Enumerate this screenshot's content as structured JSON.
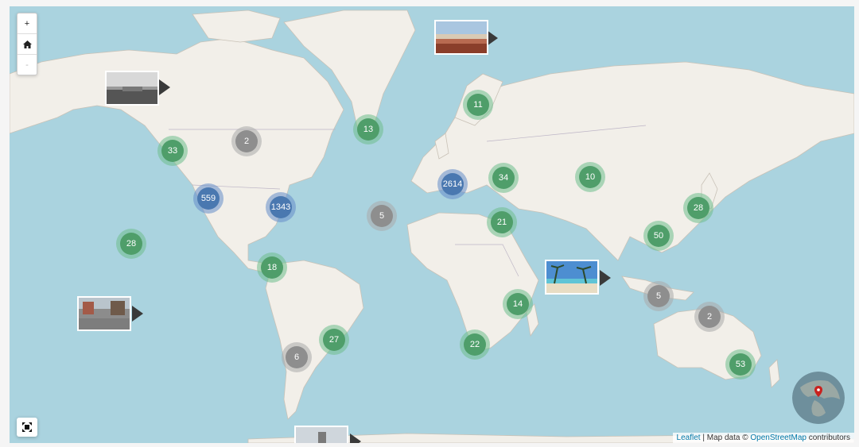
{
  "controls": {
    "zoom_in": "+",
    "home_icon": "home-icon",
    "zoom_out": "-",
    "fullscreen_icon": "fullscreen-icon"
  },
  "clusters": [
    {
      "id": "alaska",
      "count": "33",
      "color": "green"
    },
    {
      "id": "canada",
      "count": "2",
      "color": "gray"
    },
    {
      "id": "greenland",
      "count": "13",
      "color": "green"
    },
    {
      "id": "scandinavia",
      "count": "11",
      "color": "green"
    },
    {
      "id": "us-west",
      "count": "559",
      "color": "blue"
    },
    {
      "id": "us-east",
      "count": "1343",
      "color": "blue"
    },
    {
      "id": "europe",
      "count": "2614",
      "color": "blue"
    },
    {
      "id": "black-sea",
      "count": "34",
      "color": "green"
    },
    {
      "id": "russia",
      "count": "10",
      "color": "green"
    },
    {
      "id": "atlantic",
      "count": "5",
      "color": "gray"
    },
    {
      "id": "japan",
      "count": "28",
      "color": "green"
    },
    {
      "id": "hawaii",
      "count": "28",
      "color": "green"
    },
    {
      "id": "middle-east",
      "count": "21",
      "color": "green"
    },
    {
      "id": "se-asia",
      "count": "50",
      "color": "green"
    },
    {
      "id": "central-america",
      "count": "18",
      "color": "green"
    },
    {
      "id": "indonesia",
      "count": "5",
      "color": "gray"
    },
    {
      "id": "east-africa",
      "count": "14",
      "color": "green"
    },
    {
      "id": "australia-north",
      "count": "2",
      "color": "gray"
    },
    {
      "id": "brazil",
      "count": "27",
      "color": "green"
    },
    {
      "id": "south-africa",
      "count": "22",
      "color": "green"
    },
    {
      "id": "argentina",
      "count": "6",
      "color": "gray"
    },
    {
      "id": "australia-east",
      "count": "53",
      "color": "green"
    }
  ],
  "photos": [
    {
      "id": "photo-alaska",
      "scene": "harbor-town"
    },
    {
      "id": "photo-arctic",
      "scene": "red-cliffs"
    },
    {
      "id": "photo-pacific",
      "scene": "street"
    },
    {
      "id": "photo-maldives",
      "scene": "palm-beach"
    },
    {
      "id": "photo-antarctica",
      "scene": "snow-station"
    }
  ],
  "colors": {
    "water": "#aad3df",
    "land": "#f2efe9",
    "cluster_green": "#4f9e6a",
    "cluster_blue": "#4a78b0",
    "cluster_gray": "#8e8e8e"
  },
  "attribution": {
    "leaflet": "Leaflet",
    "separator": " | Map data © ",
    "osm": "OpenStreetMap",
    "suffix": " contributors"
  }
}
